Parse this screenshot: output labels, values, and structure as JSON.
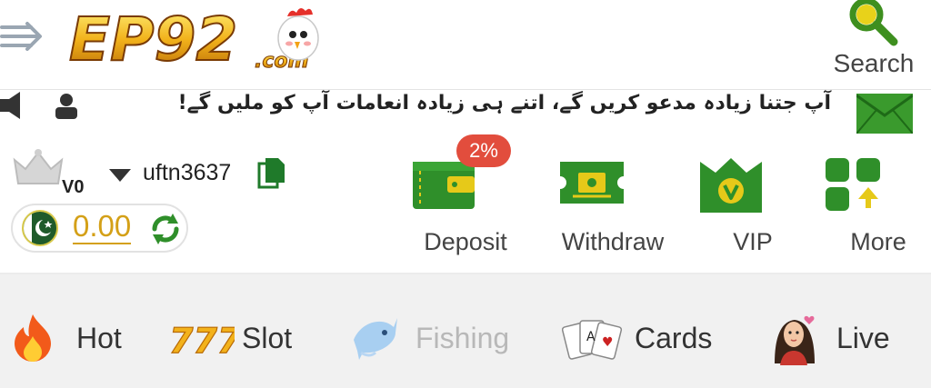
{
  "header": {
    "logo_text": "EP92",
    "logo_suffix": ".com",
    "search_label": "Search"
  },
  "marquee": {
    "text": "آپ جتنا زیادہ مدعو کریں گے، اتنے ہی زیادہ انعامات آپ کو ملیں گے!"
  },
  "user": {
    "vip_level": "V0",
    "username": "uftn3637",
    "balance": "0.00"
  },
  "actions": {
    "deposit_badge": "2%",
    "items": [
      {
        "label": "Deposit",
        "icon": "wallet-icon"
      },
      {
        "label": "Withdraw",
        "icon": "cash-ticket-icon"
      },
      {
        "label": "VIP",
        "icon": "vip-crown-icon"
      },
      {
        "label": "More",
        "icon": "grid-icon"
      }
    ]
  },
  "categories": [
    {
      "label": "Hot",
      "icon": "flame-icon",
      "active": false
    },
    {
      "label": "Slot",
      "icon": "seven-seven-seven-icon",
      "active": false
    },
    {
      "label": "Fishing",
      "icon": "fish-icon",
      "active": true
    },
    {
      "label": "Cards",
      "icon": "playing-cards-icon",
      "active": false
    },
    {
      "label": "Live",
      "icon": "live-dealer-icon",
      "active": false
    }
  ],
  "colors": {
    "accent_green": "#2f8f2a",
    "balance_gold": "#d4a017",
    "badge_red": "#e24d3d",
    "active_category_text": "#b8b8b8"
  }
}
